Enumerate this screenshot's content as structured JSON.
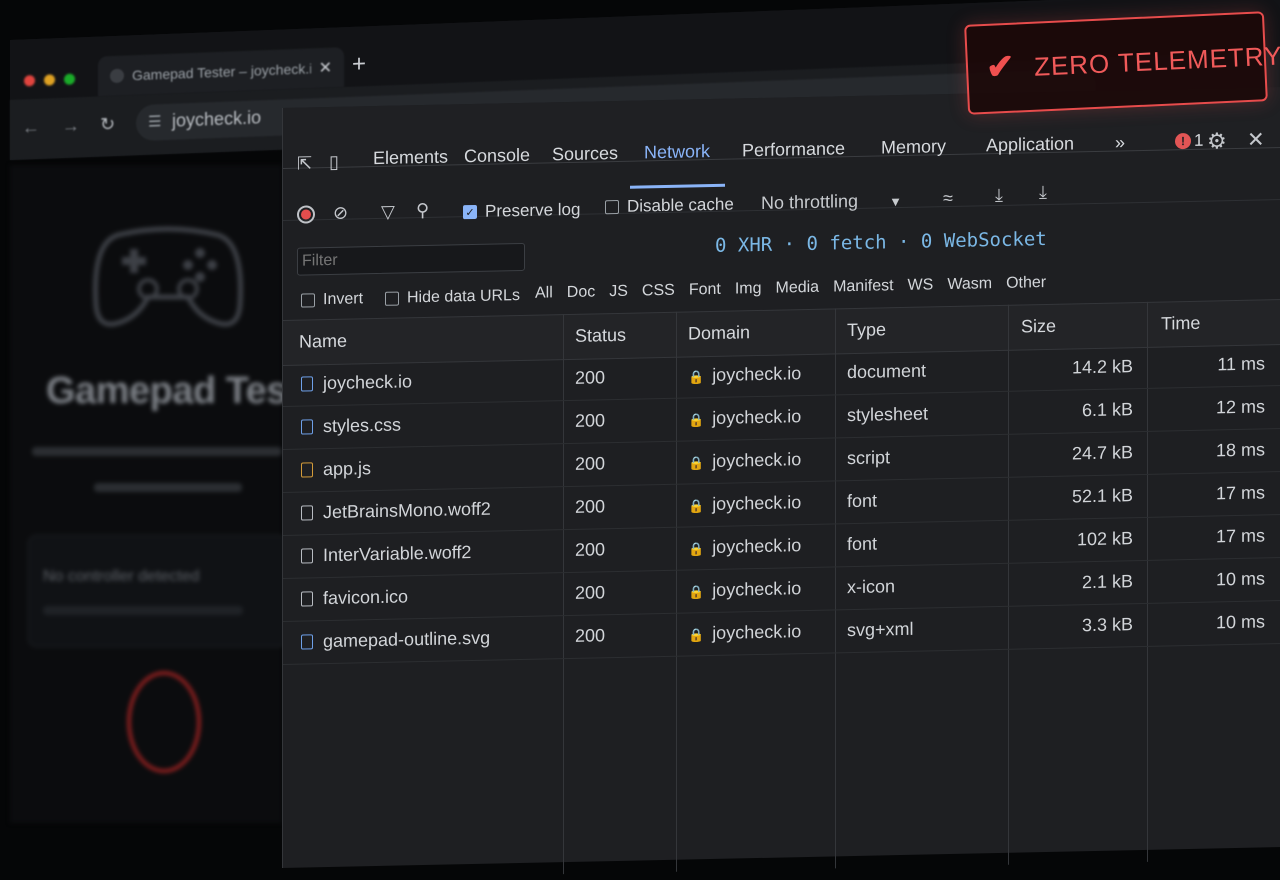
{
  "browser": {
    "tab_title": "Gamepad Tester – joycheck.io",
    "tab_close": "✕",
    "new_tab": "+",
    "url": "joycheck.io"
  },
  "page": {
    "title": "Gamepad Tester",
    "status": "No controller detected"
  },
  "devtools": {
    "tabs": [
      "Elements",
      "Console",
      "Sources",
      "Network",
      "Performance",
      "Memory",
      "Application"
    ],
    "active_tab": "Network",
    "more": "»",
    "error_count": "1",
    "close": "✕",
    "toolbar": {
      "preserve_log": "Preserve log",
      "preserve_log_checked": true,
      "disable_cache": "Disable cache",
      "disable_cache_checked": false,
      "throttling": "No throttling"
    },
    "filter_placeholder": "Filter",
    "summary": "0 XHR · 0 fetch · 0 WebSocket",
    "invert": "Invert",
    "hide_data_urls": "Hide data URLs",
    "type_filters": [
      "All",
      "Doc",
      "JS",
      "CSS",
      "Font",
      "Img",
      "Media",
      "Manifest",
      "WS",
      "Wasm",
      "Other"
    ],
    "columns": [
      "Name",
      "Status",
      "Domain",
      "Type",
      "Size",
      "Time"
    ],
    "rows": [
      {
        "name": "joycheck.io",
        "status": "200",
        "domain": "joycheck.io",
        "type": "document",
        "size": "14.2 kB",
        "time": "11 ms"
      },
      {
        "name": "styles.css",
        "status": "200",
        "domain": "joycheck.io",
        "type": "stylesheet",
        "size": "6.1 kB",
        "time": "12 ms"
      },
      {
        "name": "app.js",
        "status": "200",
        "domain": "joycheck.io",
        "type": "script",
        "size": "24.7 kB",
        "time": "18 ms"
      },
      {
        "name": "JetBrainsMono.woff2",
        "status": "200",
        "domain": "joycheck.io",
        "type": "font",
        "size": "52.1 kB",
        "time": "17 ms"
      },
      {
        "name": "InterVariable.woff2",
        "status": "200",
        "domain": "joycheck.io",
        "type": "font",
        "size": "102 kB",
        "time": "17 ms"
      },
      {
        "name": "favicon.ico",
        "status": "200",
        "domain": "joycheck.io",
        "type": "x-icon",
        "size": "2.1 kB",
        "time": "10 ms"
      },
      {
        "name": "gamepad-outline.svg",
        "status": "200",
        "domain": "joycheck.io",
        "type": "svg+xml",
        "size": "3.3 kB",
        "time": "10 ms"
      }
    ]
  },
  "badge": {
    "text": "ZERO TELEMETRY",
    "color": "#e74c4c"
  },
  "colors": {
    "accent": "#8ab4f8",
    "badge_red": "#e74c4c",
    "summary_blue": "#7bb8e6"
  }
}
